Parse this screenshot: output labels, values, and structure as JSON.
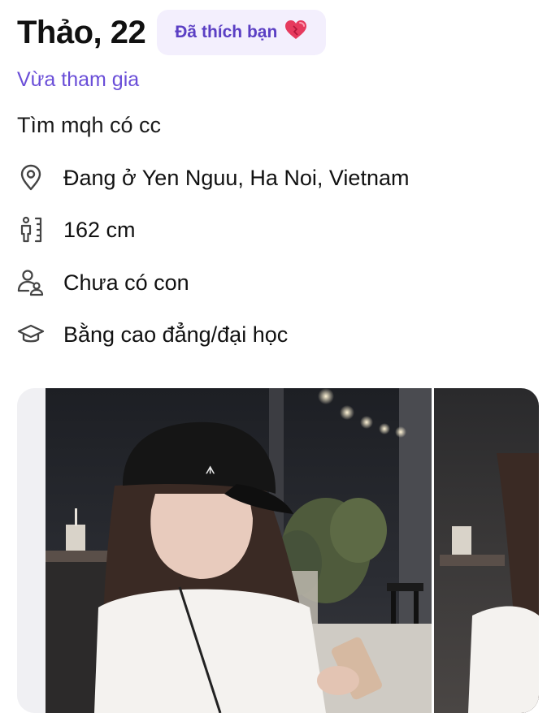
{
  "profile": {
    "name_age": "Thảo, 22",
    "liked_badge": "Đã thích bạn",
    "joined": "Vừa tham gia",
    "bio": "Tìm mqh có cc"
  },
  "info": [
    {
      "icon": "location-pin-icon",
      "text": "Đang ở Yen Nguu, Ha Noi, Vietnam"
    },
    {
      "icon": "height-icon",
      "text": "162 cm"
    },
    {
      "icon": "children-icon",
      "text": "Chưa có con"
    },
    {
      "icon": "graduation-cap-icon",
      "text": "Bằng cao đẳng/đại học"
    }
  ],
  "colors": {
    "accent": "#6a4ed8",
    "badge_bg": "#f3effd",
    "heart": "#e0245e"
  }
}
